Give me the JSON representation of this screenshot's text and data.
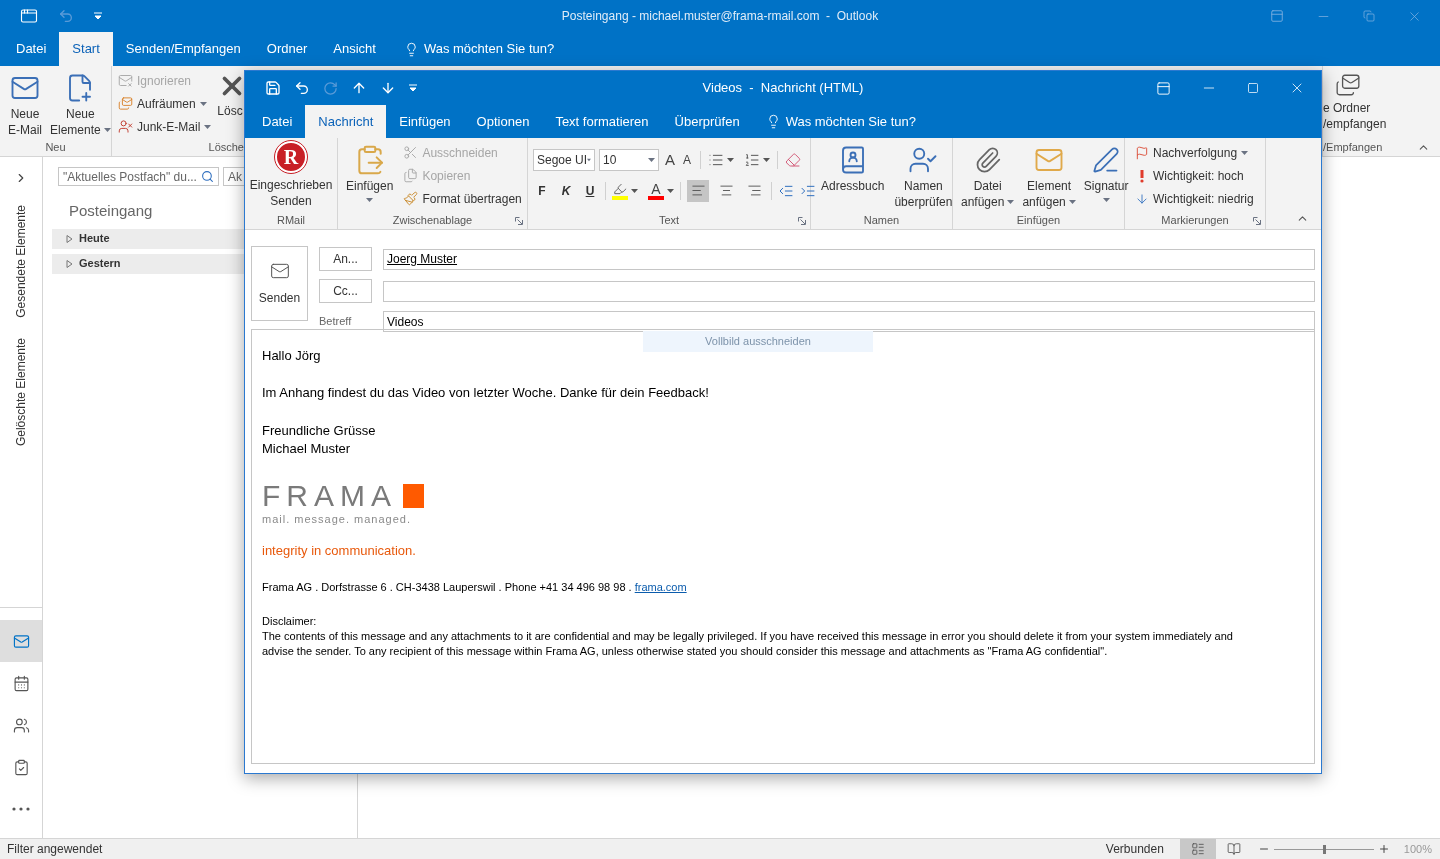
{
  "outlook": {
    "title": "Posteingang - michael.muster@frama-rmail.com  -  Outlook",
    "tabs": [
      {
        "label": "Datei",
        "selected": false
      },
      {
        "label": "Start",
        "selected": true
      },
      {
        "label": "Senden/Empfangen",
        "selected": false
      },
      {
        "label": "Ordner",
        "selected": false
      },
      {
        "label": "Ansicht",
        "selected": false
      }
    ],
    "tell_me": "Was möchten Sie tun?",
    "ribbon": {
      "new_group": {
        "label": "Neu",
        "buttons": [
          {
            "kind": "mail",
            "lines": [
              "Neue",
              "E-Mail"
            ],
            "dropdown": false
          },
          {
            "kind": "items",
            "lines": [
              "Neue",
              "Elemente"
            ],
            "dropdown": true
          }
        ]
      },
      "delete_group": {
        "label": "Lösche",
        "large": "Lösc",
        "small": [
          {
            "kind": "ignore",
            "label": "Ignorieren",
            "disabled": true,
            "dropdown": false
          },
          {
            "kind": "cleanup",
            "label": "Aufräumen",
            "disabled": false,
            "dropdown": true
          },
          {
            "kind": "junk",
            "label": "Junk-E-Mail",
            "disabled": false,
            "dropdown": true
          }
        ]
      },
      "sendreceive_group": {
        "label": "/Empfangen",
        "lines": [
          "e Ordner",
          "/empfangen"
        ]
      }
    },
    "nav": {
      "folders": [
        "Gesendete Elemente",
        "Gelöschte Elemente"
      ],
      "modules": [
        {
          "kind": "mail",
          "selected": true
        },
        {
          "kind": "calendar",
          "selected": false
        },
        {
          "kind": "people",
          "selected": false
        },
        {
          "kind": "tasks",
          "selected": false
        },
        {
          "kind": "more",
          "selected": false
        }
      ]
    },
    "folder_pane": {
      "search_placeholder": "\"Aktuelles Postfach\" du...",
      "scope": "Ak",
      "heading": "Posteingang",
      "groups": [
        {
          "label": "Heute",
          "expanded": false
        },
        {
          "label": "Gestern",
          "expanded": false
        }
      ]
    },
    "status_bar": {
      "text": "Filter angewendet",
      "connection": "Verbunden",
      "views": [
        {
          "kind": "normal",
          "selected": true
        },
        {
          "kind": "reading",
          "selected": false
        }
      ],
      "zoom": {
        "level": 0.5,
        "reading": "100%"
      }
    }
  },
  "compose": {
    "title": "Videos  -  Nachricht (HTML)",
    "tabs": [
      {
        "label": "Datei",
        "selected": false
      },
      {
        "label": "Nachricht",
        "selected": true
      },
      {
        "label": "Einfügen",
        "selected": false
      },
      {
        "label": "Optionen",
        "selected": false
      },
      {
        "label": "Text formatieren",
        "selected": false
      },
      {
        "label": "Überprüfen",
        "selected": false
      }
    ],
    "tell_me": "Was möchten Sie tun?",
    "ribbon": {
      "rmail": {
        "label": "RMail",
        "logo_letter": "R",
        "lines": [
          "Eingeschrieben",
          "Senden"
        ]
      },
      "clipboard": {
        "label": "Zwischenablage",
        "launcher": true,
        "paste": {
          "lines": [
            "Einfügen"
          ],
          "dropdown": true
        },
        "small": [
          {
            "kind": "cut",
            "label": "Ausschneiden",
            "disabled": true
          },
          {
            "kind": "copy",
            "label": "Kopieren",
            "disabled": true
          },
          {
            "kind": "format_painter",
            "label": "Format übertragen",
            "disabled": false
          }
        ]
      },
      "text": {
        "label": "Text",
        "launcher": true,
        "font": "Segoe UI",
        "size": "10",
        "grow": "A",
        "shrink": "A",
        "bold": "F",
        "italic": "K",
        "underline": "U",
        "font_color": "A",
        "alignment": [
          {
            "kind": "left",
            "selected": true
          },
          {
            "kind": "center",
            "selected": false
          },
          {
            "kind": "right",
            "selected": false
          }
        ]
      },
      "names": {
        "label": "Namen",
        "launcher": false,
        "buttons": [
          {
            "kind": "address_book",
            "lines": [
              "Adressbuch"
            ],
            "dropdown": false
          },
          {
            "kind": "check_names",
            "lines": [
              "Namen",
              "überprüfen"
            ],
            "dropdown": false
          }
        ]
      },
      "insert": {
        "label": "Einfügen",
        "launcher": false,
        "buttons": [
          {
            "kind": "attach_file",
            "lines": [
              "Datei",
              "anfügen"
            ],
            "dropdown": true
          },
          {
            "kind": "attach_item",
            "lines": [
              "Element",
              "anfügen"
            ],
            "dropdown": true
          },
          {
            "kind": "signature",
            "lines": [
              "Signatur"
            ],
            "dropdown": true
          }
        ]
      },
      "tags": {
        "label": "Markierungen",
        "launcher": true,
        "small": [
          {
            "kind": "follow_up",
            "label": "Nachverfolgung",
            "dropdown": true
          },
          {
            "kind": "high",
            "label": "Wichtigkeit: hoch",
            "dropdown": false
          },
          {
            "kind": "low",
            "label": "Wichtigkeit: niedrig",
            "dropdown": false
          }
        ]
      }
    },
    "header": {
      "send": "Senden",
      "to_button": "An...",
      "cc_button": "Cc...",
      "subject_label": "Betreff",
      "to": "Joerg Muster",
      "subject": "Videos"
    },
    "tooltip": "Vollbild ausschneiden",
    "body": {
      "greeting": "Hallo Jörg",
      "text": "Im Anhang findest du das Video von letzter Woche. Danke für dein Feedback!",
      "closing": [
        "Freundliche Grüsse",
        "Michael Muster"
      ],
      "logo": {
        "name": "FRAMA",
        "tagline": "mail. message. managed."
      },
      "slogan": "integrity in communication.",
      "address": "Frama AG . Dorfstrasse 6 . CH-3438 Lauperswil . Phone +41 34 496 98 98 . ",
      "link": "frama.com",
      "disclaimer_title": "Disclaimer:",
      "disclaimer": "The contents of this message and any attachments to it are confidential and may be legally privileged. If you have received this message in error you should delete it from your system immediately and advise the sender. To any recipient of this message within Frama AG, unless otherwise stated you should consider this message and attachments as \"Frama AG confidential\"."
    }
  }
}
